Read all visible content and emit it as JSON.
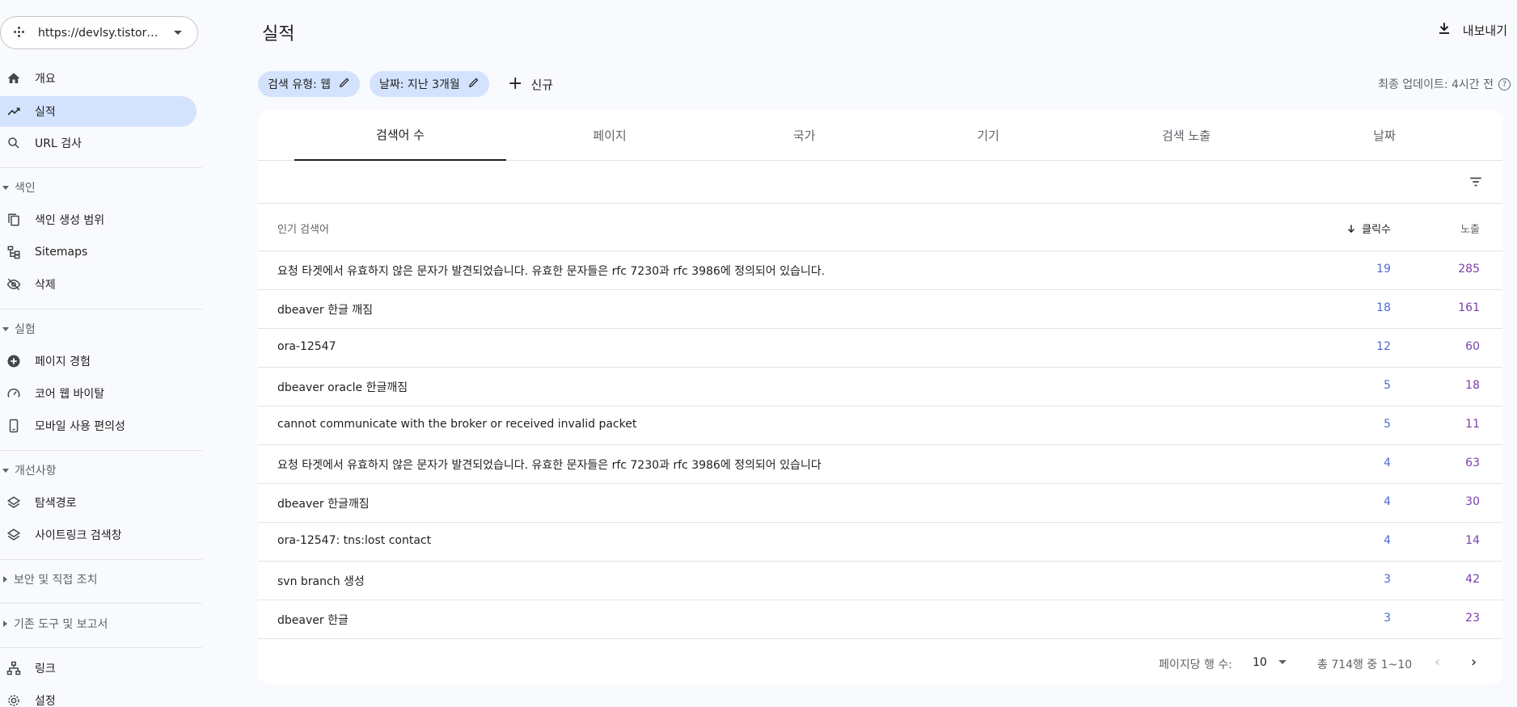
{
  "property": {
    "url": "https://devlsy.tistory.com/"
  },
  "nav": {
    "overview": "개요",
    "performance": "실적",
    "url_inspection": "URL 검사",
    "indexing_header": "색인",
    "coverage": "색인 생성 범위",
    "sitemaps": "Sitemaps",
    "removals": "삭제",
    "experience_header": "실험",
    "page_experience": "페이지 경험",
    "core_web_vitals": "코어 웹 바이탈",
    "mobile_usability": "모바일 사용 편의성",
    "enhancements_header": "개선사항",
    "breadcrumbs": "탐색경로",
    "sitelinks": "사이트링크 검색창",
    "security_header": "보안 및 직접 조치",
    "legacy_header": "기존 도구 및 보고서",
    "links": "링크",
    "settings": "설정"
  },
  "header": {
    "title": "실적",
    "export": "내보내기",
    "updated": "최종 업데이트: 4시간 전",
    "updated_help": "?"
  },
  "filters": {
    "search_type": "검색 유형: 웹",
    "date": "날짜: 지난 3개월",
    "new": "신규"
  },
  "tabs": [
    "검색어 수",
    "페이지",
    "국가",
    "기기",
    "검색 노출",
    "날짜"
  ],
  "table": {
    "col_query": "인기 검색어",
    "col_clicks": "클릭수",
    "col_impressions": "노출",
    "rows": [
      {
        "query": "요청 타겟에서 유효하지 않은 문자가 발견되었습니다. 유효한 문자들은 rfc 7230과 rfc 3986에 정의되어 있습니다.",
        "clicks": "19",
        "impressions": "285"
      },
      {
        "query": "dbeaver 한글 깨짐",
        "clicks": "18",
        "impressions": "161"
      },
      {
        "query": "ora-12547",
        "clicks": "12",
        "impressions": "60"
      },
      {
        "query": "dbeaver oracle 한글깨짐",
        "clicks": "5",
        "impressions": "18"
      },
      {
        "query": "cannot communicate with the broker or received invalid packet",
        "clicks": "5",
        "impressions": "11"
      },
      {
        "query": "요청 타겟에서 유효하지 않은 문자가 발견되었습니다. 유효한 문자들은 rfc 7230과 rfc 3986에 정의되어 있습니다",
        "clicks": "4",
        "impressions": "63"
      },
      {
        "query": "dbeaver 한글깨짐",
        "clicks": "4",
        "impressions": "30"
      },
      {
        "query": "ora-12547: tns:lost contact",
        "clicks": "4",
        "impressions": "14"
      },
      {
        "query": "svn branch 생성",
        "clicks": "3",
        "impressions": "42"
      },
      {
        "query": "dbeaver 한글",
        "clicks": "3",
        "impressions": "23"
      }
    ]
  },
  "pager": {
    "rows_per_page_label": "페이지당 행 수:",
    "rows_per_page": "10",
    "range": "총 714행 중 1~10",
    "prev": "‹",
    "next": "›"
  },
  "colors": {
    "accent": "#d3e3fd",
    "clicks": "#4c6bd2",
    "impressions": "#7b3fa8"
  }
}
